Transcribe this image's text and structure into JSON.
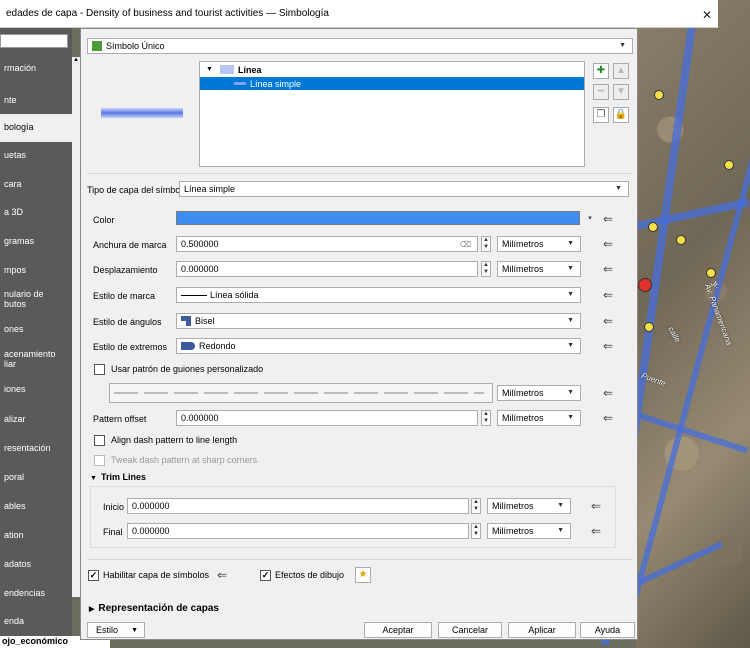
{
  "window": {
    "title": "edades de capa - Density of business and tourist activities — Simbología",
    "close": "✕"
  },
  "sidebar": {
    "items": [
      {
        "label": "rmación"
      },
      {
        "label": "nte"
      },
      {
        "label": "bología"
      },
      {
        "label": "uetas"
      },
      {
        "label": "cara"
      },
      {
        "label": "a 3D"
      },
      {
        "label": "gramas"
      },
      {
        "label": "mpos"
      },
      {
        "label": "nulario de\nbutos"
      },
      {
        "label": "ones"
      },
      {
        "label": "acenamiento\nliar"
      },
      {
        "label": "iones"
      },
      {
        "label": "alizar"
      },
      {
        "label": "resentación"
      },
      {
        "label": "poral"
      },
      {
        "label": "ables"
      },
      {
        "label": "ation"
      },
      {
        "label": "adatos"
      },
      {
        "label": "endencias"
      },
      {
        "label": "enda"
      }
    ],
    "active_index": 2,
    "footer": "ojo_económico"
  },
  "renderer": {
    "label": "Símbolo Único"
  },
  "tree": {
    "root": "Línea",
    "child": "Línea simple"
  },
  "symbol_layer_type": {
    "label": "Tipo de capa del símbolo",
    "value": "Línea simple"
  },
  "props": {
    "color_label": "Color",
    "color_value": "#3e8ef2",
    "width_label": "Anchura de marca",
    "width_value": "0.500000",
    "width_unit": "Milímetros",
    "offset_label": "Desplazamiento",
    "offset_value": "0.000000",
    "offset_unit": "Milímetros",
    "stroke_style_label": "Estilo de marca",
    "stroke_style_value": "Línea sólida",
    "join_label": "Estilo de ángulos",
    "join_value": "Bisel",
    "cap_label": "Estilo de extremos",
    "cap_value": "Redondo",
    "custom_dash_label": "Usar patrón de guiones personalizado",
    "dash_unit": "Milímetros",
    "pattern_offset_label": "Pattern offset",
    "pattern_offset_value": "0.000000",
    "pattern_offset_unit": "Milímetros",
    "align_dash_label": "Align dash pattern to line length",
    "tweak_dash_label": "Tweak dash pattern at sharp corners"
  },
  "trim": {
    "header": "Trim Lines",
    "start_label": "Inicio",
    "start_value": "0.000000",
    "start_unit": "Milímetros",
    "end_label": "Final",
    "end_value": "0.000000",
    "end_unit": "Milímetros"
  },
  "bottom": {
    "enable_layer_label": "Habilitar capa de símbolos",
    "draw_effects_label": "Efectos de dibujo",
    "layer_render_label": "Representación de capas"
  },
  "buttons": {
    "style": "Estilo",
    "ok": "Aceptar",
    "cancel": "Cancelar",
    "apply": "Aplicar",
    "help": "Ayuda"
  },
  "map_labels": [
    "Av. Panamericana",
    "Puente",
    "calle",
    "Jr."
  ]
}
